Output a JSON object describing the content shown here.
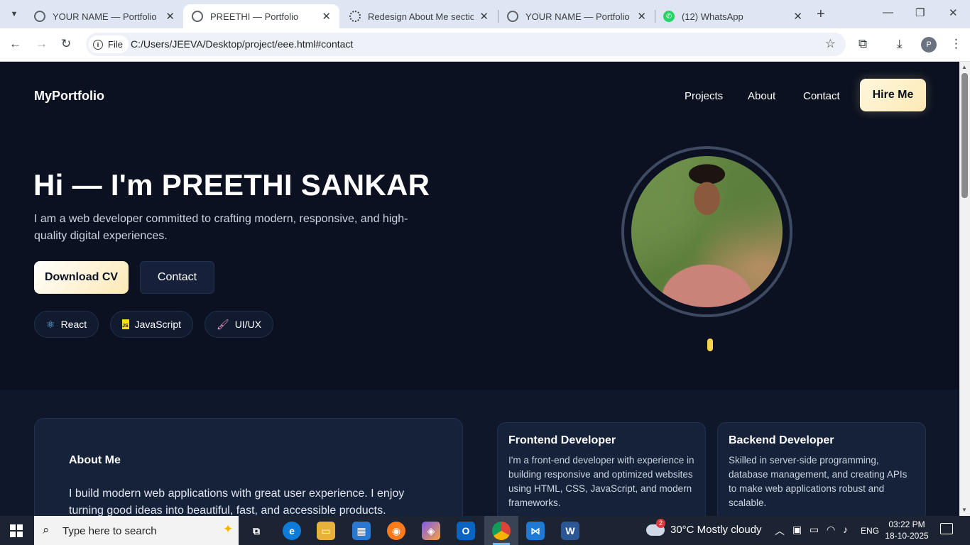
{
  "browser": {
    "tabs": [
      {
        "label": "YOUR NAME — Portfolio (Gr",
        "icon": "globe-icon"
      },
      {
        "label": "PREETHI — Portfolio",
        "icon": "globe-icon",
        "active": true
      },
      {
        "label": "Redesign About Me section",
        "icon": "chatgpt-icon"
      },
      {
        "label": "YOUR NAME — Portfolio",
        "icon": "globe-icon"
      },
      {
        "label": "(12) WhatsApp",
        "icon": "whatsapp-icon"
      }
    ],
    "tab_close": "✕",
    "new_tab": "+",
    "minimize": "—",
    "maximize": "❐",
    "close": "✕",
    "back": "←",
    "forward": "→",
    "reload": "↻",
    "chip_label": "File",
    "url": "C:/Users/JEEVA/Desktop/project/eee.html#contact",
    "profile_initial": "P"
  },
  "site": {
    "brand": "MyPortfolio",
    "nav": [
      "Projects",
      "About",
      "Contact"
    ],
    "hire_label": "Hire Me",
    "hero": {
      "title": "Hi — I'm PREETHI SANKAR",
      "subtitle": "I am a web developer committed to crafting modern, responsive, and high-quality digital experiences.",
      "cv_label": "Download CV",
      "contact_label": "Contact"
    },
    "skills": [
      {
        "label": "React",
        "icon": "react-icon"
      },
      {
        "label": "JavaScript",
        "icon": "js-icon"
      },
      {
        "label": "UI/UX",
        "icon": "brush-icon"
      }
    ],
    "about": {
      "title": "About Me",
      "text": "I build modern web applications with great user experience. I enjoy turning good ideas into beautiful, fast, and accessible products."
    },
    "cards": [
      {
        "title": "Frontend Developer",
        "text": "I'm a front-end developer with experience in building responsive and optimized websites using HTML, CSS, JavaScript, and modern frameworks."
      },
      {
        "title": "Backend Developer",
        "text": "Skilled in server-side programming, database management, and creating APIs to make web applications robust and scalable."
      }
    ]
  },
  "taskbar": {
    "search_placeholder": "Type here to search",
    "apps": [
      "task-view-icon",
      "edge-icon",
      "file-explorer-icon",
      "store-icon",
      "firefox-icon",
      "copilot-icon",
      "outlook-icon",
      "chrome-icon",
      "vscode-icon",
      "word-icon"
    ],
    "weather_badge": "2",
    "weather": "30°C  Mostly cloudy",
    "language": "ENG",
    "time": "03:22 PM",
    "date": "18-10-2025"
  },
  "colors": {
    "page_bg": "#0b1120",
    "accent_gold": "#fde9b5",
    "card_bg": "#16213a"
  }
}
